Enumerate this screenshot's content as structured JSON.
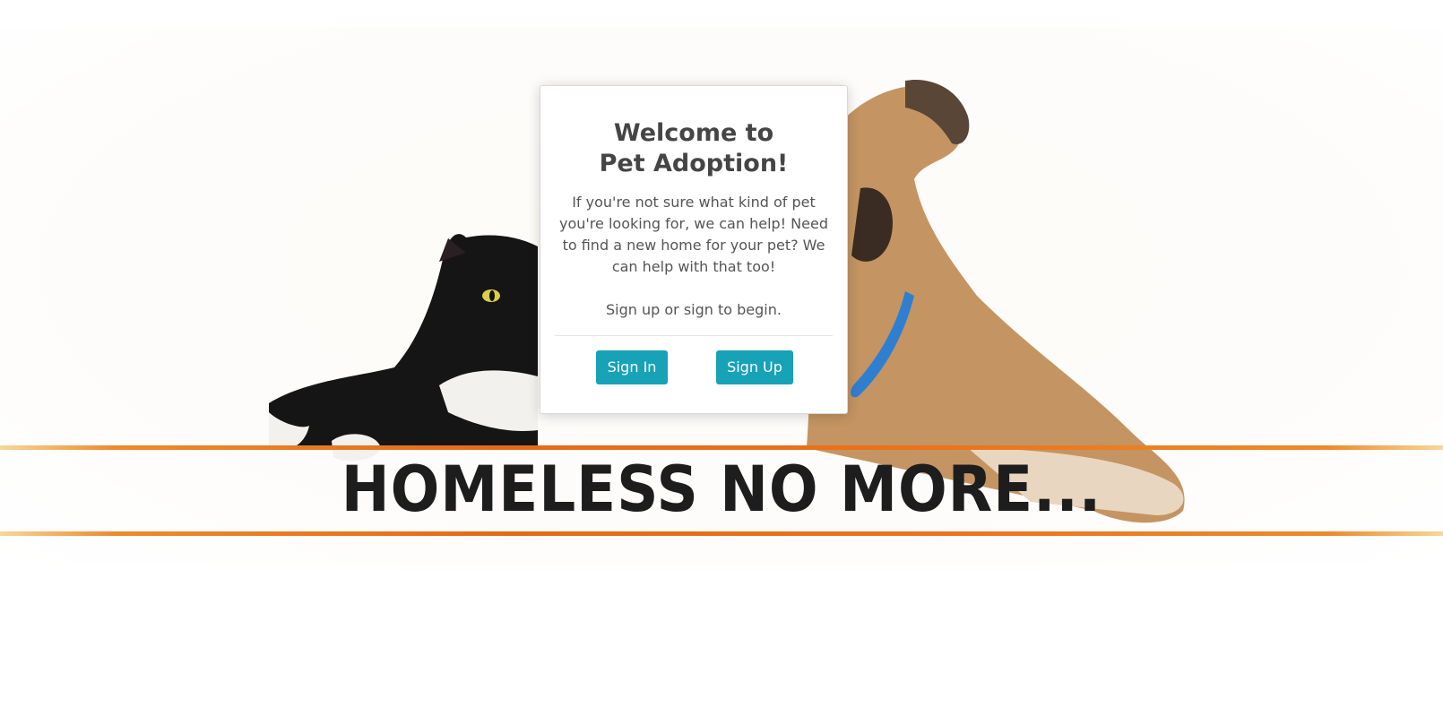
{
  "hero": {
    "slogan": "HOMELESS NO MORE...",
    "accent_color": "#e46a17"
  },
  "modal": {
    "title_line1": "Welcome to",
    "title_line2": "Pet Adoption!",
    "description": "If you're not sure what kind of pet you're looking for, we can help! Need to find a new home for your pet? We can help with that too!",
    "call_to_action": "Sign up or sign to begin.",
    "sign_in_label": "Sign In",
    "sign_up_label": "Sign Up",
    "button_color": "#17a2b8"
  }
}
